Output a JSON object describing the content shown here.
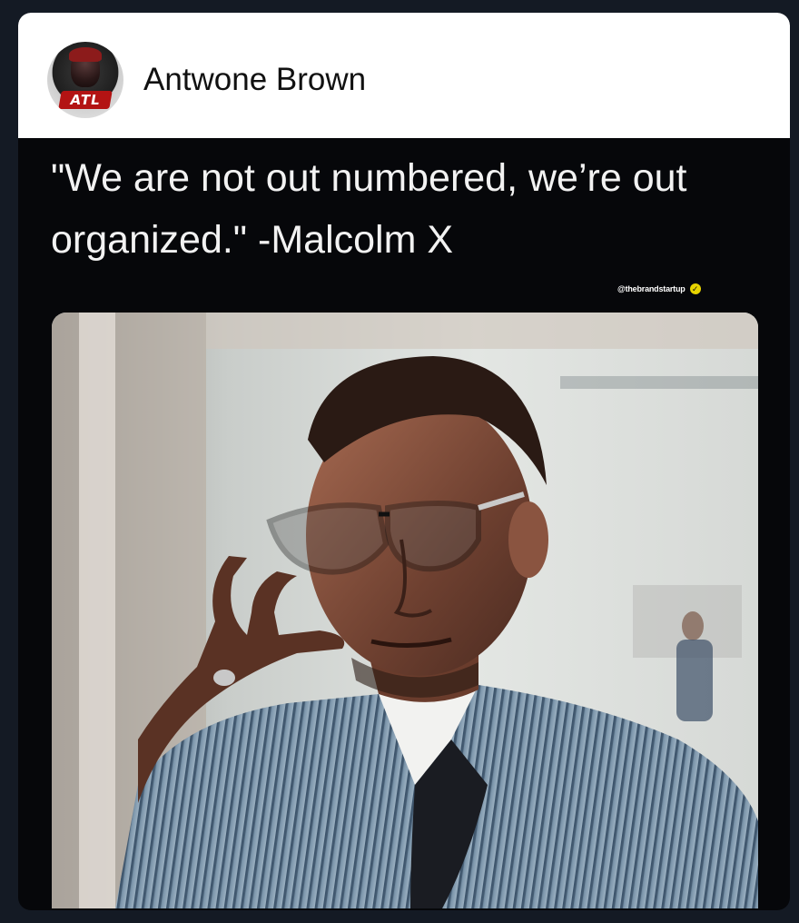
{
  "post": {
    "author": {
      "name": "Antwone Brown",
      "avatar_badge": "ATL"
    },
    "quote": "\"We are not out numbered, we’re out organized.\" -Malcolm X",
    "watermark_handle": "@thebrandstartup",
    "watermark_icon": "verified-icon"
  },
  "colors": {
    "page_background": "#141a24",
    "card_background": "#06070a",
    "header_background": "#ffffff",
    "verified_badge": "#e8d400",
    "avatar_badge": "#b31313"
  }
}
